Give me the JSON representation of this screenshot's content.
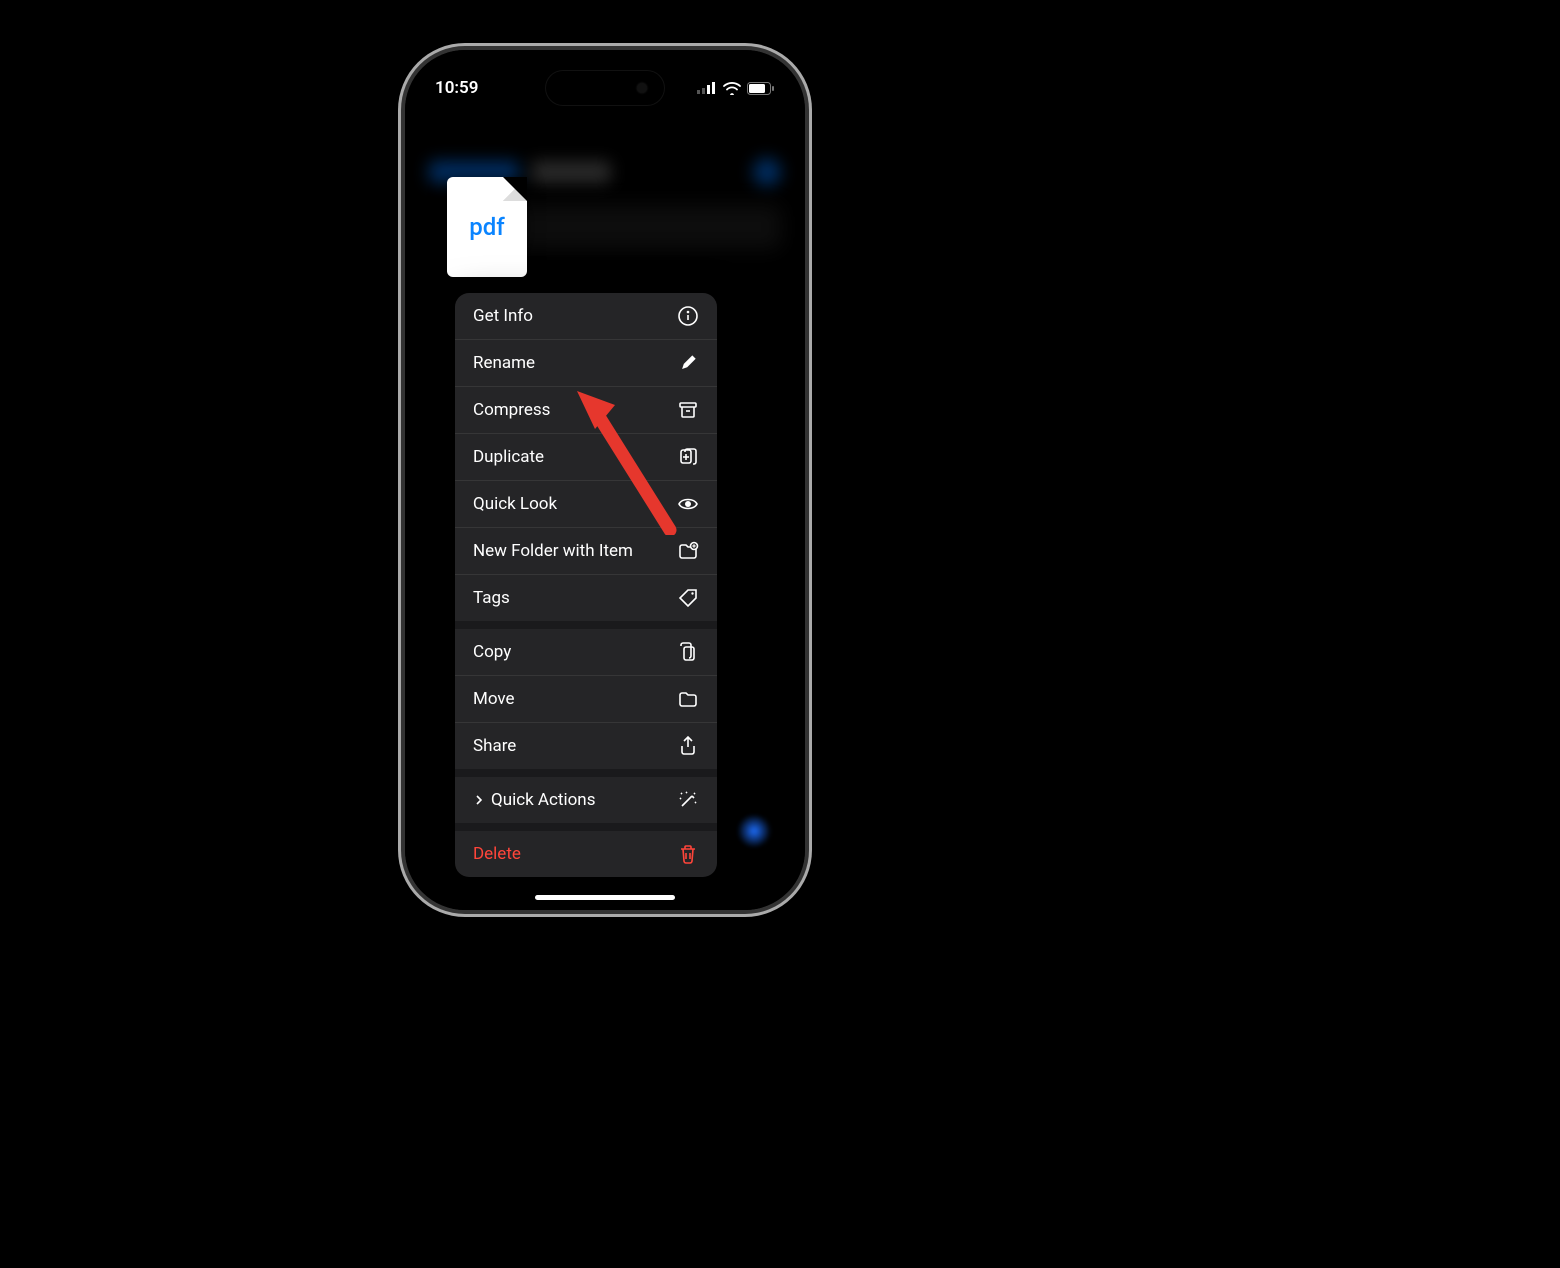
{
  "statusbar": {
    "time": "10:59"
  },
  "file": {
    "type_label": "pdf"
  },
  "menu": {
    "group1": [
      {
        "label": "Get Info",
        "icon": "info"
      },
      {
        "label": "Rename",
        "icon": "pencil"
      },
      {
        "label": "Compress",
        "icon": "archivebox"
      },
      {
        "label": "Duplicate",
        "icon": "duplicate"
      },
      {
        "label": "Quick Look",
        "icon": "eye"
      },
      {
        "label": "New Folder with Item",
        "icon": "folder-plus"
      },
      {
        "label": "Tags",
        "icon": "tag"
      }
    ],
    "group2": [
      {
        "label": "Copy",
        "icon": "copy"
      },
      {
        "label": "Move",
        "icon": "folder"
      },
      {
        "label": "Share",
        "icon": "share"
      }
    ],
    "group3": [
      {
        "label": "Quick Actions",
        "icon": "wand",
        "chevron": true
      }
    ],
    "group4": [
      {
        "label": "Delete",
        "icon": "trash",
        "danger": true
      }
    ]
  },
  "annotation": {
    "target": "Compress"
  }
}
